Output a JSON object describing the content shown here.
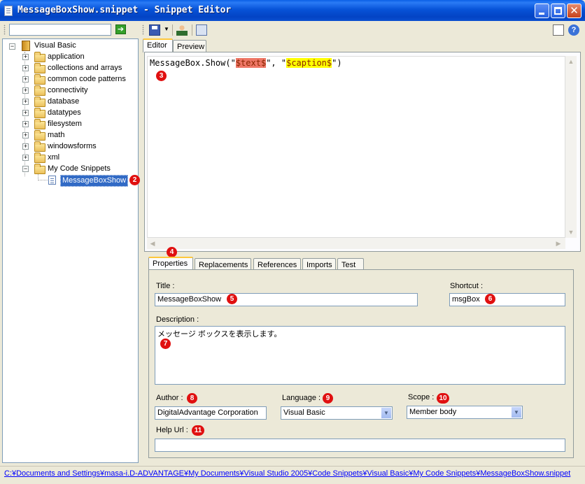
{
  "window": {
    "title": "MessageBoxShow.snippet - Snippet Editor",
    "close_glyph": "✕"
  },
  "left_toolbar": {
    "search_value": "",
    "go_glyph": "➔"
  },
  "tree": {
    "root": "Visual Basic",
    "folders": [
      "application",
      "collections and arrays",
      "common code patterns",
      "connectivity",
      "database",
      "datatypes",
      "filesystem",
      "math",
      "windowsforms",
      "xml",
      "My Code Snippets"
    ],
    "selected_item": "MessageBoxShow"
  },
  "badges": {
    "b2": "2",
    "b3": "3",
    "b4": "4",
    "b5": "5",
    "b6": "6",
    "b7": "7",
    "b8": "8",
    "b9": "9",
    "b10": "10",
    "b11": "11"
  },
  "editor_tabs": [
    "Editor",
    "Preview"
  ],
  "code": {
    "prefix": "MessageBox.Show(\"",
    "token1": "$text$",
    "middle": "\", \"",
    "token2": "$caption$",
    "suffix": "\")"
  },
  "property_tabs": [
    "Properties",
    "Replacements",
    "References",
    "Imports",
    "Test"
  ],
  "properties": {
    "title_label": "Title :",
    "title_value": "MessageBoxShow",
    "shortcut_label": "Shortcut :",
    "shortcut_value": "msgBox",
    "description_label": "Description :",
    "description_value": "メッセージ ボックスを表示します。",
    "author_label": "Author :",
    "author_value": "DigitalAdvantage Corporation",
    "language_label": "Language :",
    "language_value": "Visual Basic",
    "scope_label": "Scope :",
    "scope_value": "Member body",
    "helpurl_label": "Help Url :",
    "helpurl_value": ""
  },
  "statusbar": {
    "path": "C:¥Documents and Settings¥masa-i.D-ADVANTAGE¥My Documents¥Visual Studio 2005¥Code Snippets¥Visual Basic¥My Code Snippets¥MessageBoxShow.snippet"
  },
  "colors": {
    "titlebar": "#0753D8",
    "selection": "#316AC5",
    "badge": "#E01010",
    "token1_bg": "#EE7766",
    "token2_bg": "#FFFF00",
    "link": "#0000FF"
  }
}
